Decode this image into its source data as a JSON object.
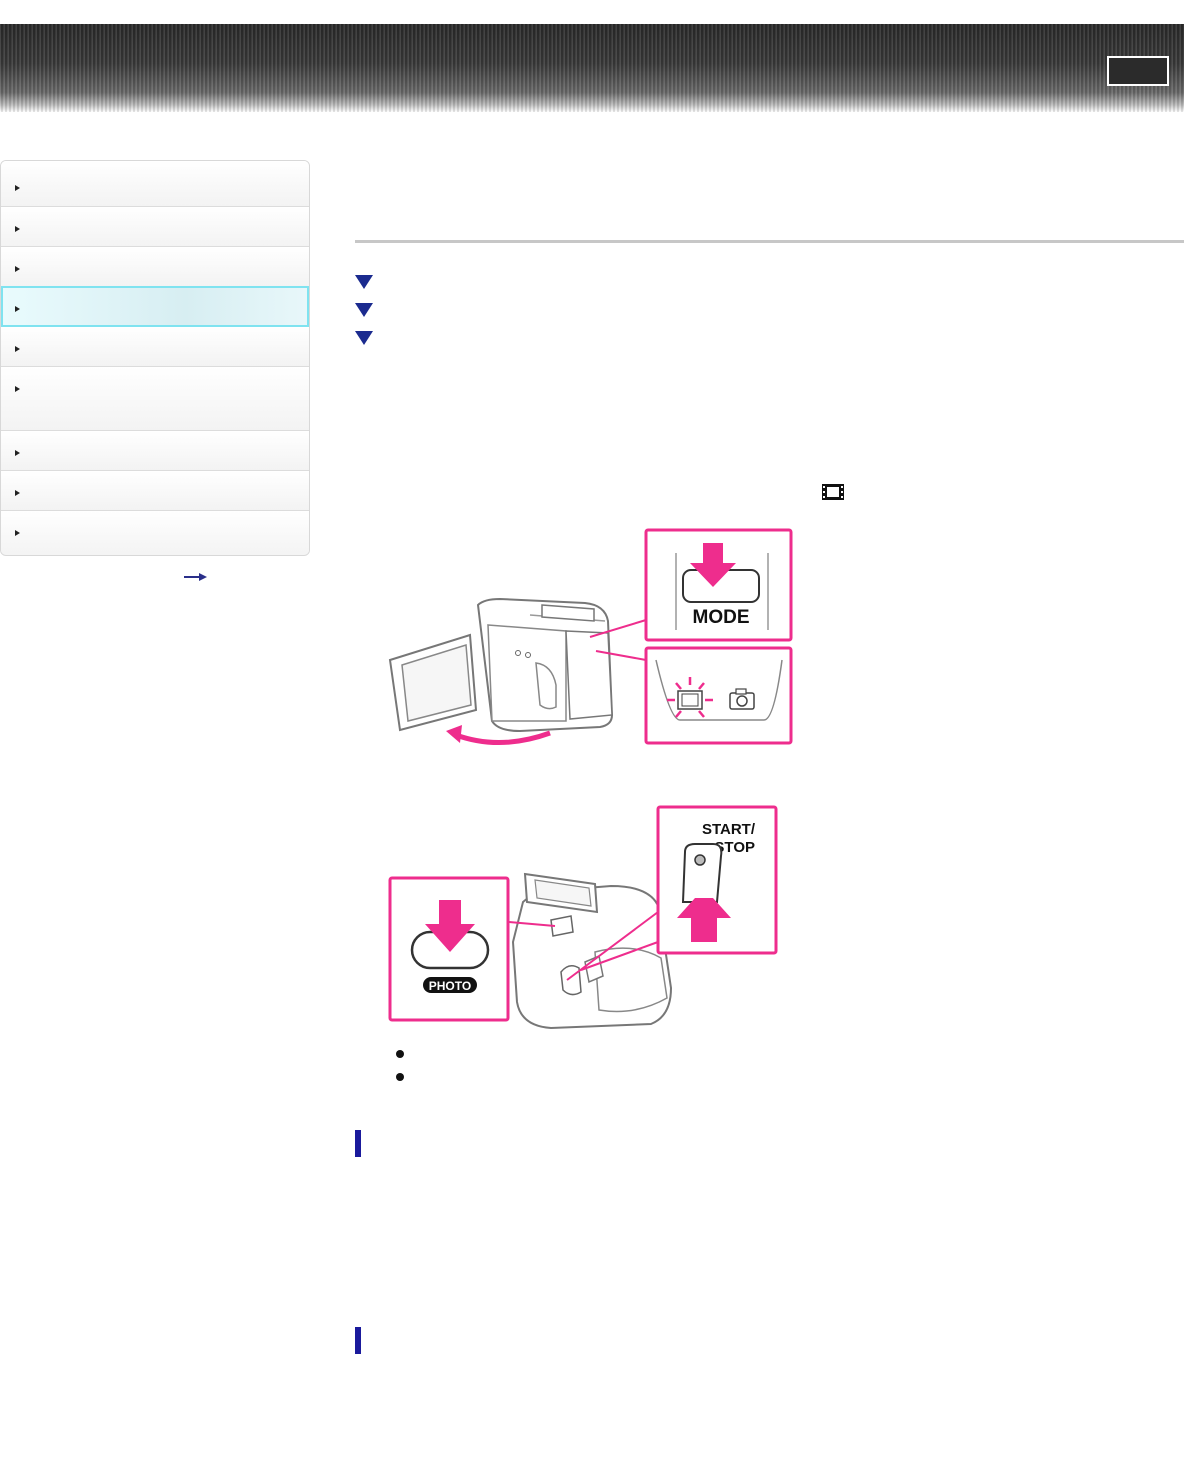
{
  "illustration_1": {
    "mode_button_label": "MODE"
  },
  "illustration_2": {
    "start_stop_label": "START/\nSTOP",
    "start_stop_line1": "START/",
    "start_stop_line2": "STOP",
    "photo_label": "PHOTO"
  },
  "colors": {
    "accent_magenta": "#ee2d8d",
    "toc_arrow": "#1b2b8f",
    "section_bar": "#1a1a9c",
    "active_item_border": "#7fe3f0"
  },
  "icons": [
    "movie-mode-icon",
    "photo-mode-icon",
    "arrow-right-icon",
    "triangle-down-icon"
  ]
}
